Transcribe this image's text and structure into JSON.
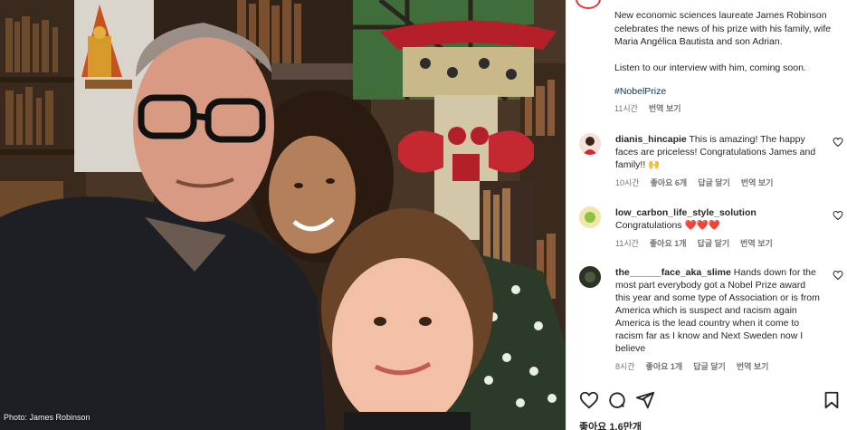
{
  "post": {
    "caption_line1": "New economic sciences laureate James Robinson celebrates the news of his prize with his family, wife Maria Angélica Bautista and son Adrian.",
    "caption_line2": "Listen to our interview with him, coming soon.",
    "hashtag": "#NobelPrize",
    "time": "11시간",
    "translate": "번역 보기"
  },
  "photo": {
    "credit": "Photo: James Robinson"
  },
  "comments": [
    {
      "user": "dianis_hincapie",
      "text": "This is amazing! The happy faces are priceless! Congratulations James and family!! 🙌",
      "time": "10시간",
      "likes": "좋아요 6개",
      "reply": "답글 달기",
      "translate": "번역 보기"
    },
    {
      "user": "low_carbon_life_style_solution",
      "text": "Congratulations ❤️❤️❤️",
      "time": "11시간",
      "likes": "좋아요 1개",
      "reply": "답글 달기",
      "translate": "번역 보기"
    },
    {
      "user": "the______face_aka_slime",
      "text": "Hands down for the most part everybody got a Nobel Prize award this year and some type of Association or is from America which is suspect and racism again America is the lead country when it come to racism far as I know and Next Sweden now I believe",
      "time": "8시간",
      "likes": "좋아요 1개",
      "reply": "답글 달기",
      "translate": "번역 보기"
    }
  ],
  "footer": {
    "likes": "좋아요 1.6만개"
  },
  "icons": {
    "like": "heart-icon",
    "comment": "comment-icon",
    "share": "share-icon",
    "save": "bookmark-icon"
  }
}
